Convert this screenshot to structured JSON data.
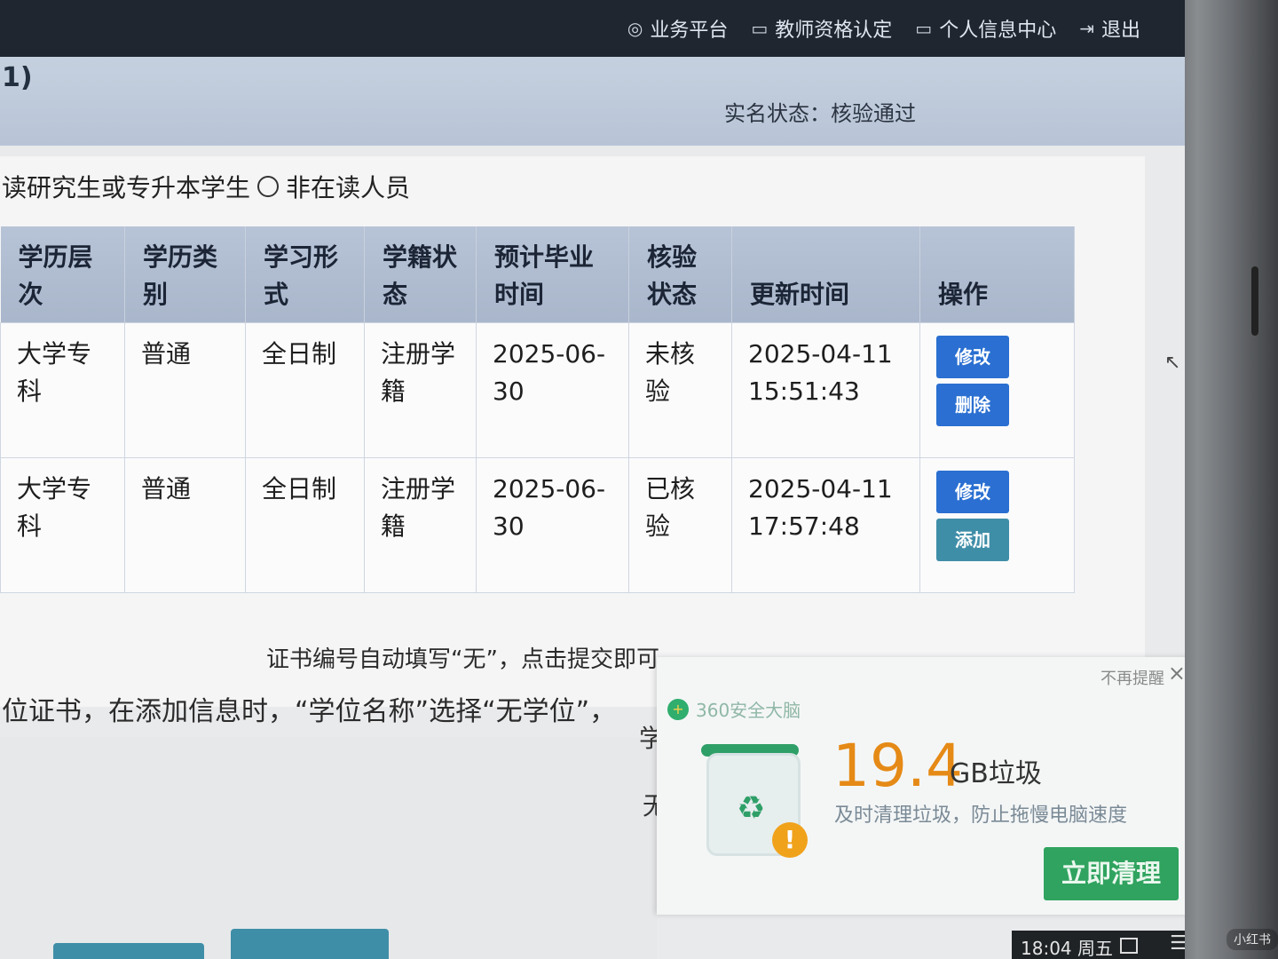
{
  "topbar": {
    "items": [
      {
        "label": "业务平台",
        "icon": "platform-icon"
      },
      {
        "label": "教师资格认定",
        "icon": "monitor-icon"
      },
      {
        "label": "个人信息中心",
        "icon": "monitor-icon"
      },
      {
        "label": "退出",
        "icon": "logout-icon"
      }
    ]
  },
  "header": {
    "title_fragment": "1)",
    "real_name_status": "实名状态：核验通过"
  },
  "student_type": {
    "option_fragment": "读研究生或专升本学生",
    "option_non_student": "非在读人员"
  },
  "table": {
    "headers": [
      "学历层次",
      "学历类别",
      "学习形式",
      "学籍状态",
      "预计毕业时间",
      "核验状态",
      "更新时间",
      "操作"
    ],
    "rows": [
      {
        "level": "大学专科",
        "category": "普通",
        "mode": "全日制",
        "status": "注册学籍",
        "grad_date": "2025-06-30",
        "verify": "未核验",
        "updated_date": "2025-04-11",
        "updated_time": "15:51:43",
        "actions": [
          "修改",
          "删除"
        ]
      },
      {
        "level": "大学专科",
        "category": "普通",
        "mode": "全日制",
        "status": "注册学籍",
        "grad_date": "2025-06-30",
        "verify": "已核验",
        "updated_date": "2025-04-11",
        "updated_time": "17:57:48",
        "actions": [
          "修改",
          "添加"
        ]
      }
    ]
  },
  "notes": {
    "line1": "证书编号自动填写“无”，点击提交即可。",
    "line2": "位证书，在添加信息时，“学位名称”选择“无学位”，",
    "frag_a": "学",
    "frag_b": "无"
  },
  "popup": {
    "brand": "360安全大脑",
    "no_remind": "不再提醒",
    "trash_amount": "19.4",
    "trash_unit": "GB垃圾",
    "tip": "及时清理垃圾，防止拖慢电脑速度",
    "clean_button": "立即清理"
  },
  "taskbar": {
    "clock": "18:04 周五"
  },
  "watermark": "小红书"
}
